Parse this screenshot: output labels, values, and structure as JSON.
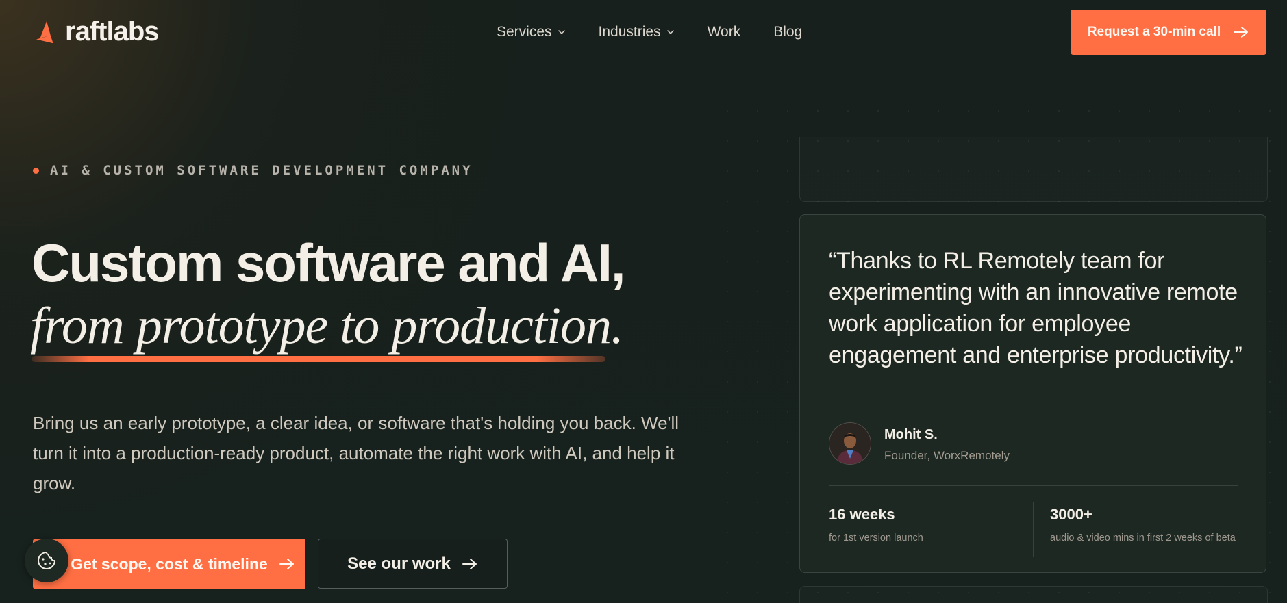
{
  "brand": {
    "name": "raftlabs",
    "accent": "#ff6f43",
    "background": "#17201c"
  },
  "nav": {
    "links": [
      {
        "label": "Services",
        "dropdown": true
      },
      {
        "label": "Industries",
        "dropdown": true
      },
      {
        "label": "Work",
        "dropdown": false
      },
      {
        "label": "Blog",
        "dropdown": false
      }
    ],
    "cta_label": "Request a 30-min call"
  },
  "hero": {
    "eyebrow": "AI & CUSTOM SOFTWARE DEVELOPMENT COMPANY",
    "headline_line1": "Custom software and AI,",
    "headline_line2": "from prototype to production.",
    "lead": "Bring us an early prototype, a clear idea, or software that's holding you back. We'll turn it into a production-ready product, automate the right work with AI, and help it grow.",
    "primary_cta": "Get scope, cost & timeline",
    "secondary_cta": "See our work"
  },
  "testimonial": {
    "quote": "“Thanks to RL Remotely team for experimenting with an innovative remote work application for employee engagement and enterprise productivity.”",
    "author_name": "Mohit S.",
    "author_role": "Founder, WorxRemotely",
    "stats": [
      {
        "value": "16 weeks",
        "label": "for 1st version launch"
      },
      {
        "value": "3000+",
        "label": "audio & video mins in first 2 weeks of beta"
      }
    ]
  },
  "icons": {
    "logo": "raftlabs-logo-icon",
    "chevron": "chevron-down-icon",
    "arrow": "arrow-right-icon",
    "cookie": "cookie-icon"
  }
}
